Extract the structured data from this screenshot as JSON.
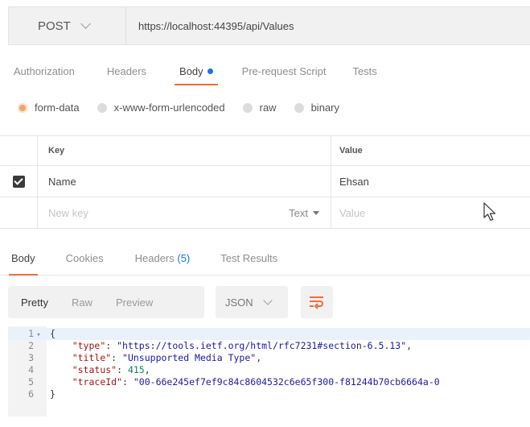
{
  "request": {
    "method": "POST",
    "url": "https://localhost:44395/api/Values"
  },
  "request_tabs": [
    {
      "label": "Authorization",
      "active": false
    },
    {
      "label": "Headers",
      "active": false
    },
    {
      "label": "Body",
      "active": true
    },
    {
      "label": "Pre-request Script",
      "active": false
    },
    {
      "label": "Tests",
      "active": false
    }
  ],
  "body_types": [
    {
      "label": "form-data",
      "checked": true
    },
    {
      "label": "x-www-form-urlencoded",
      "checked": false
    },
    {
      "label": "raw",
      "checked": false
    },
    {
      "label": "binary",
      "checked": false
    }
  ],
  "kv_table": {
    "headers": {
      "key": "Key",
      "value": "Value"
    },
    "rows": [
      {
        "checked": true,
        "key": "Name",
        "value": "Ehsan"
      }
    ],
    "new_row": {
      "key_placeholder": "New key",
      "type": "Text",
      "value_placeholder": "Value"
    }
  },
  "response_tabs": [
    {
      "label": "Body",
      "active": true
    },
    {
      "label": "Cookies",
      "active": false
    },
    {
      "label": "Headers",
      "count": "(5)",
      "active": false
    },
    {
      "label": "Test Results",
      "active": false
    }
  ],
  "response_toolbar": {
    "views": [
      "Pretty",
      "Raw",
      "Preview"
    ],
    "active_view": "Pretty",
    "format": "JSON"
  },
  "response_body": {
    "open_brace": "{",
    "close_brace": "}",
    "line_numbers": [
      "1",
      "2",
      "3",
      "4",
      "5",
      "6"
    ],
    "fields": [
      {
        "key": "\"type\"",
        "value": "\"https://tools.ietf.org/html/rfc7231#section-6.5.13\"",
        "kind": "string",
        "trailing": ","
      },
      {
        "key": "\"title\"",
        "value": "\"Unsupported Media Type\"",
        "kind": "string",
        "trailing": ","
      },
      {
        "key": "\"status\"",
        "value": "415",
        "kind": "number",
        "trailing": ","
      },
      {
        "key": "\"traceId\"",
        "value": "\"00-66e245ef7ef9c84c8604532c6e65f300-f81244b70cb6664a-0",
        "kind": "string",
        "trailing": ""
      }
    ]
  },
  "colors": {
    "accent": "#f26b3a",
    "link_blue": "#1d73e8"
  }
}
